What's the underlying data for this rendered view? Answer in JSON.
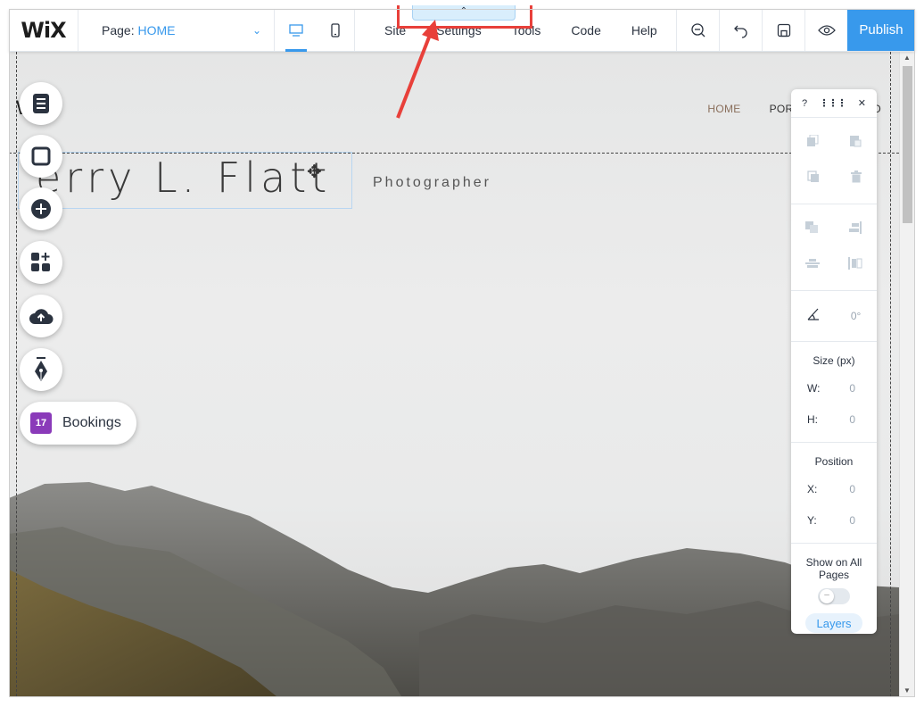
{
  "topbar": {
    "logo": "WiX",
    "page_label": "Page:",
    "page_value": "HOME",
    "menu": [
      "Site",
      "Settings",
      "Tools",
      "Code",
      "Help"
    ],
    "publish": "Publish"
  },
  "site": {
    "logo_text": "W",
    "nav": [
      "HOME",
      "PORTFOLIO",
      "BIO"
    ],
    "title": "erry L. Flatt",
    "subtitle": "Photographer"
  },
  "left_toolbar": {
    "bookings_label": "Bookings",
    "bookings_day": "17"
  },
  "panel": {
    "help": "?",
    "rotation": "0°",
    "size_label": "Size (px)",
    "w_label": "W:",
    "w_value": "0",
    "h_label": "H:",
    "h_value": "0",
    "position_label": "Position",
    "x_label": "X:",
    "x_value": "0",
    "y_label": "Y:",
    "y_value": "0",
    "show_all_pages": "Show on All Pages",
    "layers": "Layers"
  },
  "colors": {
    "accent": "#3899ec",
    "highlight": "#e8403a",
    "bookings": "#8a3ab9"
  }
}
